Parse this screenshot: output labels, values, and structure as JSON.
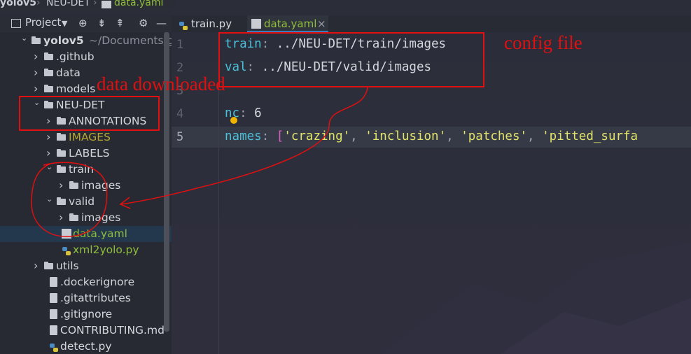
{
  "breadcrumb": {
    "project": "yolov5",
    "folder": "NEU-DET",
    "file": "data.yaml"
  },
  "project_toolbar": {
    "title": "Project",
    "icons": [
      "dropdown-icon",
      "target-icon",
      "expand-all-icon",
      "collapse-all-icon",
      "gear-icon",
      "minimize-icon"
    ]
  },
  "tree": [
    {
      "label": "yolov5",
      "extra": "~/Documents/githu",
      "kind": "folder",
      "expanded": true,
      "depth": 0,
      "bold": true
    },
    {
      "label": ".github",
      "kind": "folder",
      "expanded": false,
      "depth": 1
    },
    {
      "label": "data",
      "kind": "folder",
      "expanded": false,
      "depth": 1
    },
    {
      "label": "models",
      "kind": "folder",
      "expanded": false,
      "depth": 1
    },
    {
      "label": "NEU-DET",
      "kind": "folder",
      "expanded": true,
      "depth": 1
    },
    {
      "label": "ANNOTATIONS",
      "kind": "folder",
      "expanded": false,
      "depth": 2
    },
    {
      "label": "IMAGES",
      "kind": "folder",
      "expanded": false,
      "depth": 2,
      "color": "#b6a52e"
    },
    {
      "label": "LABELS",
      "kind": "folder",
      "expanded": false,
      "depth": 2
    },
    {
      "label": "train",
      "kind": "folder",
      "expanded": true,
      "depth": 2
    },
    {
      "label": "images",
      "kind": "folder",
      "expanded": false,
      "depth": 3
    },
    {
      "label": "valid",
      "kind": "folder",
      "expanded": true,
      "depth": 2
    },
    {
      "label": "images",
      "kind": "folder",
      "expanded": false,
      "depth": 3
    },
    {
      "label": "data.yaml",
      "kind": "yml",
      "depth": 2,
      "selected": true,
      "color": "#8fbf3a"
    },
    {
      "label": "xml2yolo.py",
      "kind": "py",
      "depth": 2,
      "color": "#8fbf3a"
    },
    {
      "label": "utils",
      "kind": "folder",
      "expanded": false,
      "depth": 1
    },
    {
      "label": ".dockerignore",
      "kind": "file",
      "depth": 1
    },
    {
      "label": ".gitattributes",
      "kind": "file",
      "depth": 1
    },
    {
      "label": ".gitignore",
      "kind": "file",
      "depth": 1
    },
    {
      "label": "CONTRIBUTING.md",
      "kind": "md",
      "depth": 1
    },
    {
      "label": "detect.py",
      "kind": "py",
      "depth": 1
    }
  ],
  "tabs": [
    {
      "label": "train.py",
      "active": false
    },
    {
      "label": "data.yaml",
      "active": true,
      "close": "×"
    }
  ],
  "editor": {
    "line_numbers": [
      "1",
      "2",
      "3",
      "4",
      "5"
    ],
    "lines": [
      {
        "key": "train",
        "colon": ":",
        "value": " ../NEU-DET/train/images"
      },
      {
        "key": "val",
        "colon": ":",
        "value": " ../NEU-DET/valid/images"
      },
      {
        "key": "",
        "colon": "",
        "value": ""
      },
      {
        "key": "nc",
        "colon": ":",
        "value": " 6"
      },
      {
        "key": "names",
        "colon": ":",
        "value": ""
      }
    ],
    "names_tokens": [
      "'crazing'",
      "'inclusion'",
      "'patches'",
      "'pitted_surfa"
    ]
  },
  "annotations": {
    "config_label": "config  file",
    "data_label": "data  downloaded",
    "color": "#e01010"
  }
}
